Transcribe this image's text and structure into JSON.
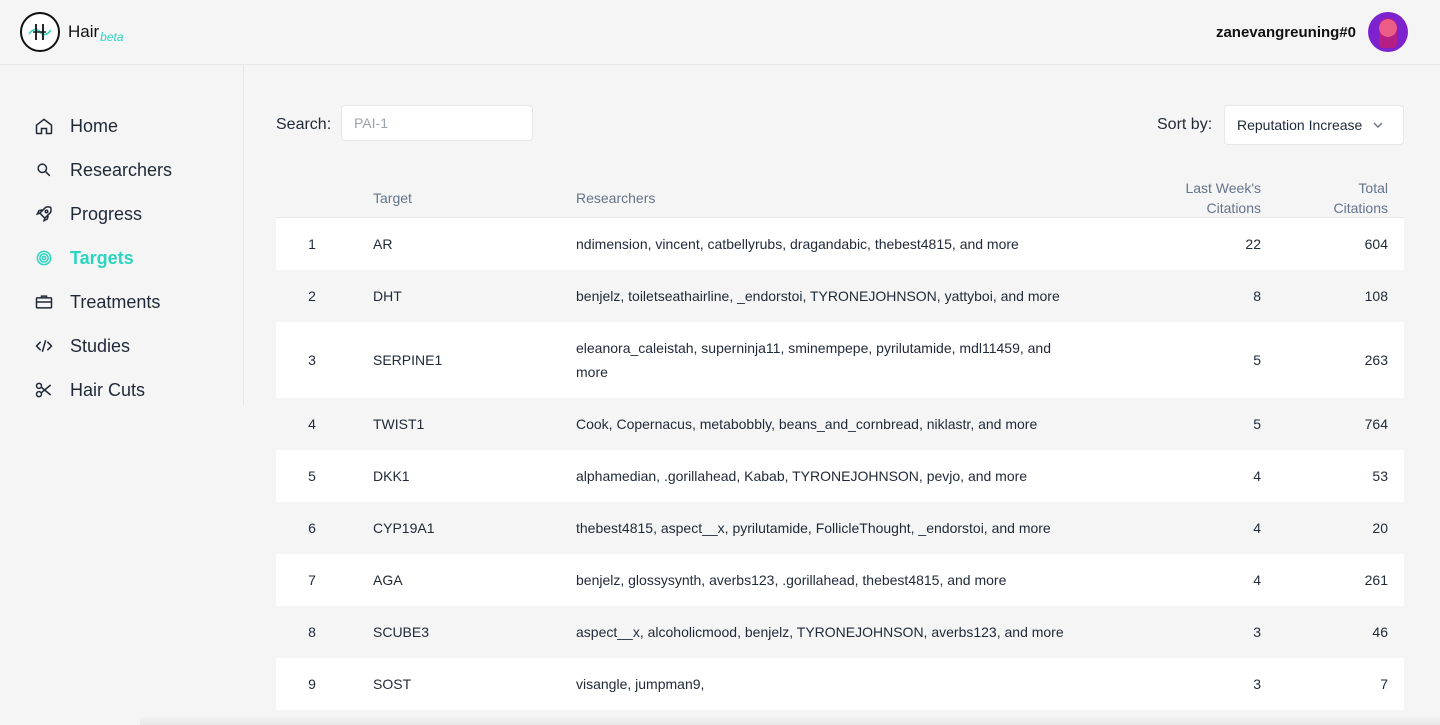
{
  "app": {
    "name": "Hair",
    "badge": "beta"
  },
  "user": {
    "username": "zanevangreuning#0"
  },
  "sidebar": {
    "items": [
      {
        "label": "Home",
        "icon": "home-icon",
        "active": false
      },
      {
        "label": "Researchers",
        "icon": "search-icon",
        "active": false
      },
      {
        "label": "Progress",
        "icon": "rocket-icon",
        "active": false
      },
      {
        "label": "Targets",
        "icon": "target-icon",
        "active": true
      },
      {
        "label": "Treatments",
        "icon": "briefcase-icon",
        "active": false
      },
      {
        "label": "Studies",
        "icon": "code-icon",
        "active": false
      },
      {
        "label": "Hair Cuts",
        "icon": "scissors-icon",
        "active": false
      }
    ]
  },
  "toolbar": {
    "search_label": "Search:",
    "search_placeholder": "PAI-1",
    "sort_label": "Sort by:",
    "sort_value": "Reputation Increase"
  },
  "table": {
    "headers": {
      "target": "Target",
      "researchers": "Researchers",
      "week_line1": "Last Week's",
      "week_line2": "Citations",
      "total_line1": "Total",
      "total_line2": "Citations"
    },
    "rows": [
      {
        "index": "1",
        "target": "AR",
        "researchers": "ndimension, vincent, catbellyrubs, dragandabic, thebest4815, and more",
        "week": "22",
        "total": "604"
      },
      {
        "index": "2",
        "target": "DHT",
        "researchers": "benjelz, toiletseathairline, _endorstoi, TYRONEJOHNSON, yattyboi, and more",
        "week": "8",
        "total": "108"
      },
      {
        "index": "3",
        "target": "SERPINE1",
        "researchers": "eleanora_caleistah, superninja11, sminempepe, pyrilutamide, mdl11459, and more",
        "week": "5",
        "total": "263"
      },
      {
        "index": "4",
        "target": "TWIST1",
        "researchers": "Cook, Copernacus, metabobbly, beans_and_cornbread, niklastr, and more",
        "week": "5",
        "total": "764"
      },
      {
        "index": "5",
        "target": "DKK1",
        "researchers": "alphamedian, .gorillahead, Kabab, TYRONEJOHNSON, pevjo, and more",
        "week": "4",
        "total": "53"
      },
      {
        "index": "6",
        "target": "CYP19A1",
        "researchers": "thebest4815, aspect__x, pyrilutamide, FollicleThought, _endorstoi, and more",
        "week": "4",
        "total": "20"
      },
      {
        "index": "7",
        "target": "AGA",
        "researchers": "benjelz, glossysynth, averbs123, .gorillahead, thebest4815, and more",
        "week": "4",
        "total": "261"
      },
      {
        "index": "8",
        "target": "SCUBE3",
        "researchers": "aspect__x, alcoholicmood, benjelz, TYRONEJOHNSON, averbs123, and more",
        "week": "3",
        "total": "46"
      },
      {
        "index": "9",
        "target": "SOST",
        "researchers": "visangle, jumpman9,",
        "week": "3",
        "total": "7"
      }
    ]
  },
  "colors": {
    "accent": "#2dd4bf",
    "text": "#1f2937",
    "muted": "#64748b",
    "background": "#f5f5f5"
  }
}
